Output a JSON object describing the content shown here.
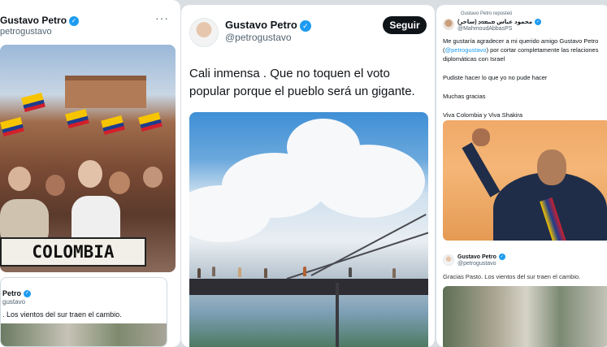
{
  "left_post": {
    "author_name": "Gustavo Petro",
    "author_handle": "petrogustavo",
    "more_label": "···",
    "banner_text": "COLOMBIA",
    "quote": {
      "author_name": "Petro",
      "author_handle": "gustavo",
      "text": ". Los vientos del sur traen el cambio."
    }
  },
  "main_post": {
    "author_name": "Gustavo Petro",
    "author_handle": "@petrogustavo",
    "follow_label": "Seguir",
    "text": "Cali inmensa . Que no toquen el voto popular porque el pueblo será un gigante."
  },
  "right_post": {
    "retweet_label": "Gustavo Petro reposteó",
    "author_name": "محمود عباس ܡܚܡܘܕ (ساحر)",
    "author_handle": "@MahmoudAbbasPS",
    "body": {
      "p1_before": "Me gustaría agradecer a mi querido amigo Gustavo Petro (",
      "p1_link": "@petrogustavo",
      "p1_after": ") por cortar completamente las relaciones diplomáticas con Israel",
      "p2": "Pudiste hacer lo que yo no pude hacer",
      "p3": "Muchas gracias",
      "p4": "Viva Colombia y Viva Shakira"
    },
    "quote": {
      "author_name": "Gustavo Petro",
      "author_handle": "@petrogustavo",
      "text": "Gracias Pasto. Los vientos del sur traen el cambio."
    }
  },
  "colors": {
    "verified": "#1d9bf0",
    "follow_button": "#0f1419",
    "link": "#1d9bf0"
  },
  "icons": [
    "verified-badge-icon",
    "more-options-icon"
  ]
}
